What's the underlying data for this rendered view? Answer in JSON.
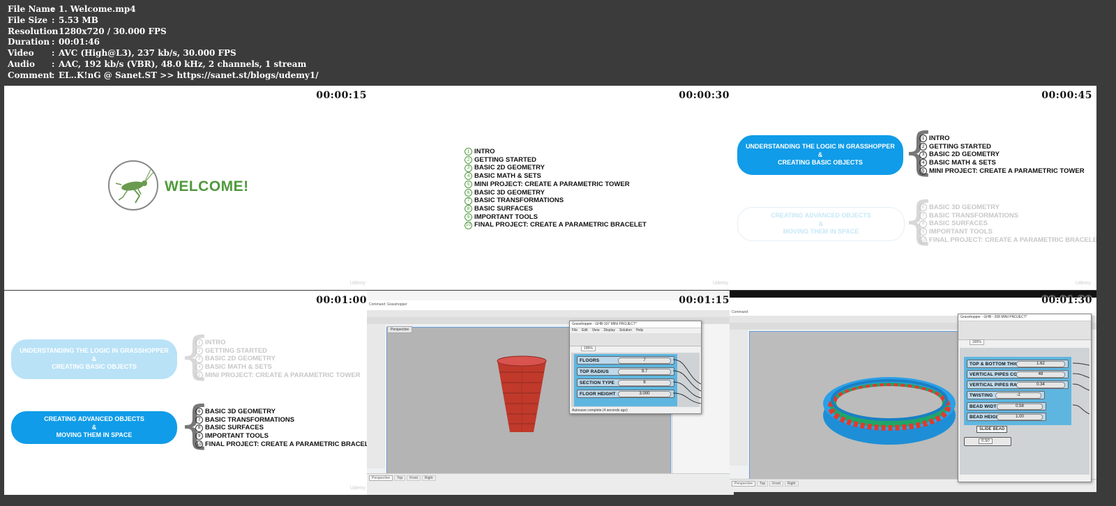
{
  "meta": {
    "rows": [
      {
        "key": "File Name",
        "sep": ":",
        "value": "1. Welcome.mp4"
      },
      {
        "key": "File Size",
        "sep": ":",
        "value": "5.53 MB"
      },
      {
        "key": "Resolution",
        "sep": ":",
        "value": "1280x720 / 30.000 FPS"
      },
      {
        "key": "Duration",
        "sep": ":",
        "value": "00:01:46"
      },
      {
        "key": "Video",
        "sep": ":",
        "value": "AVC (High@L3), 237 kb/s, 30.000 FPS"
      },
      {
        "key": "Audio",
        "sep": ":",
        "value": "AAC, 192 kb/s (VBR), 48.0 kHz, 2 channels, 1 stream"
      },
      {
        "key": "Comment",
        "sep": ":",
        "value": "EL..K!nG @ Sanet.ST  >> https://sanet.st/blogs/udemy1/"
      }
    ]
  },
  "thumbs": {
    "t1": {
      "ts": "00:00:15",
      "welcome": "WELCOME!"
    },
    "t2": {
      "ts": "00:00:30"
    },
    "t3": {
      "ts": "00:00:45"
    },
    "t4": {
      "ts": "00:01:00"
    },
    "t5": {
      "ts": "00:01:15"
    },
    "t6": {
      "ts": "00:01:30"
    }
  },
  "toc": [
    {
      "n": "1",
      "label": "INTRO"
    },
    {
      "n": "2",
      "label": "GETTING STARTED"
    },
    {
      "n": "3",
      "label": "BASIC 2D GEOMETRY"
    },
    {
      "n": "4",
      "label": "BASIC MATH & SETS"
    },
    {
      "n": "5",
      "label": "MINI PROJECT: CREATE A PARAMETRIC TOWER"
    },
    {
      "n": "6",
      "label": "BASIC 3D GEOMETRY"
    },
    {
      "n": "7",
      "label": "BASIC TRANSFORMATIONS"
    },
    {
      "n": "8",
      "label": "BASIC SURFACES"
    },
    {
      "n": "9",
      "label": "IMPORTANT TOOLS"
    },
    {
      "n": "10",
      "label": "FINAL PROJECT: CREATE A PARAMETRIC BRACELET"
    }
  ],
  "pills": {
    "logic_l1": "UNDERSTANDING THE LOGIC IN GRASSHOPPER",
    "amp": "&",
    "logic_l2": "CREATING  BASIC OBJECTS",
    "adv_l1": "CREATING  ADVANCED OBJECTS",
    "adv_l2": "MOVING THEM IN SPACE"
  },
  "tower": {
    "gh_title": "Grasshopper - GHB-107 MINI PROJECT*",
    "menu": [
      "File",
      "Edit",
      "View",
      "Display",
      "Solution",
      "Help"
    ],
    "zoom": "195%",
    "sliders": [
      {
        "label": "FLOORS",
        "value": "7"
      },
      {
        "label": "TOP RADIUS",
        "value": "9.7"
      },
      {
        "label": "SECTION TYPE",
        "value": "6"
      },
      {
        "label": "FLOOR HEIGHT",
        "value": "3.000"
      }
    ],
    "status": "Autosave complete (4 seconds ago)",
    "viewport": "Perspective",
    "command": "Command: Grasshopper",
    "viewtabs": [
      "Perspective",
      "Top",
      "Front",
      "Right"
    ]
  },
  "bracelet": {
    "gh_title": "Grasshopper - GHB - 208 MINI PROJECT*",
    "zoom": "165%",
    "sliders": [
      {
        "label": "TOP & BOTTOM THICKNESS",
        "value": "1.62"
      },
      {
        "label": "VERTICAL PIPES COUNT",
        "value": "48"
      },
      {
        "label": "VERTICAL PIPES RADIUS",
        "value": "0.34"
      },
      {
        "label": "TWISTING",
        "value": "-2"
      },
      {
        "label": "BEAD WIDTH",
        "value": "0.58"
      },
      {
        "label": "BEAD HEIGHT",
        "value": "1.00"
      }
    ],
    "slide_btn": "SLIDE BEAD",
    "slide_val": "0.50",
    "command": "Command:",
    "viewtabs": [
      "Perspective",
      "Top",
      "Front",
      "Right"
    ]
  },
  "colors": {
    "accent": "#109ce8",
    "green": "#4f9a3c",
    "tower": "#c0392b"
  }
}
